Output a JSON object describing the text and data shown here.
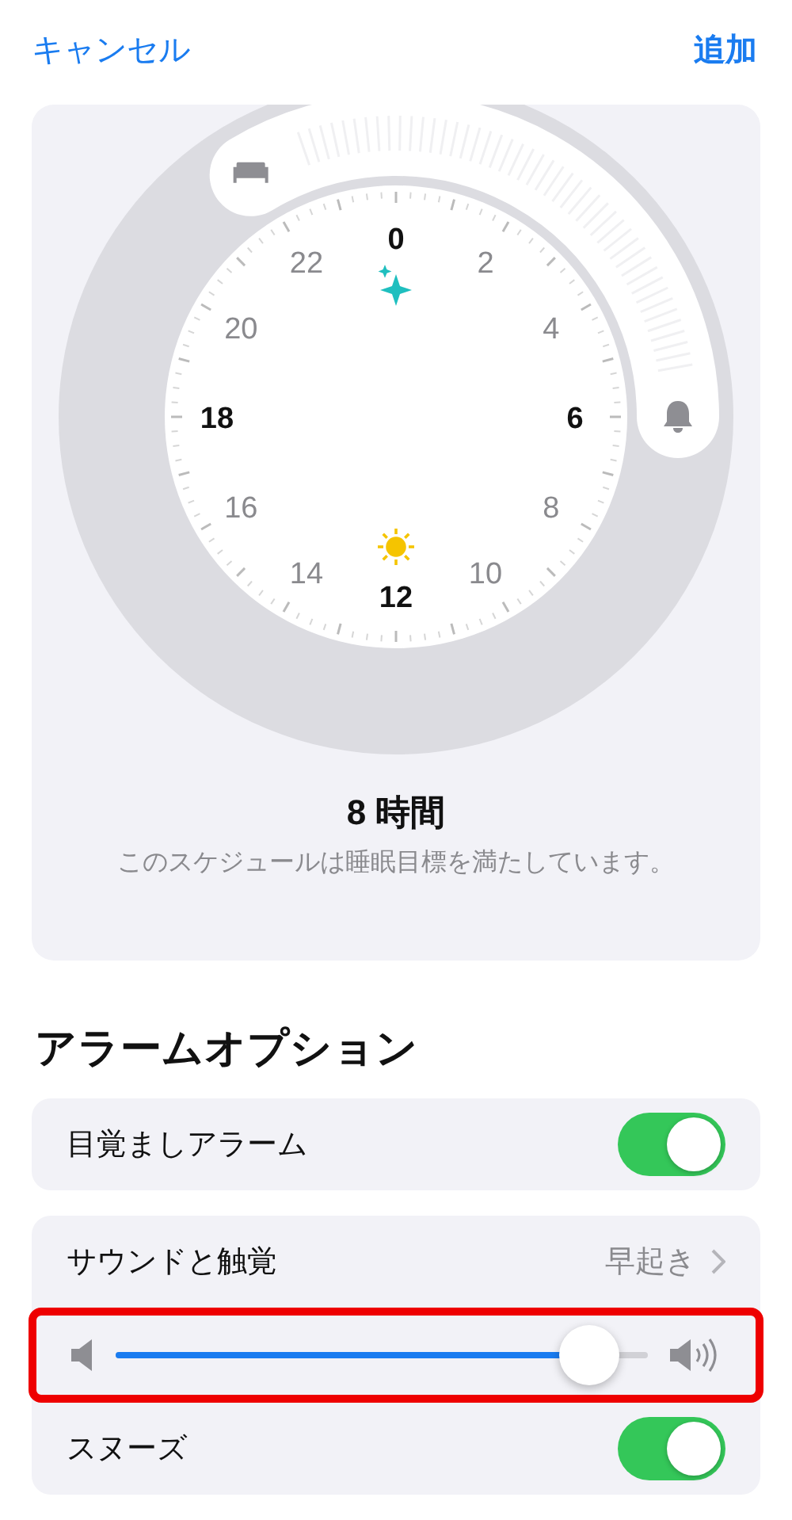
{
  "nav": {
    "cancel": "キャンセル",
    "add": "追加"
  },
  "clock": {
    "hour_labels": [
      {
        "label": "0",
        "bold": true
      },
      {
        "label": "2",
        "bold": false
      },
      {
        "label": "4",
        "bold": false
      },
      {
        "label": "6",
        "bold": true
      },
      {
        "label": "8",
        "bold": false
      },
      {
        "label": "10",
        "bold": false
      },
      {
        "label": "12",
        "bold": true
      },
      {
        "label": "14",
        "bold": false
      },
      {
        "label": "16",
        "bold": false
      },
      {
        "label": "18",
        "bold": true
      },
      {
        "label": "20",
        "bold": false
      },
      {
        "label": "22",
        "bold": false
      }
    ],
    "duration": "8 時間",
    "note": "このスケジュールは睡眠目標を満たしています。"
  },
  "section_title": "アラームオプション",
  "groups": [
    [
      {
        "kind": "toggle",
        "label": "目覚ましアラーム",
        "on": true
      }
    ],
    [
      {
        "kind": "link",
        "label": "サウンドと触覚",
        "value": "早起き"
      },
      {
        "kind": "slider",
        "level": 0.94,
        "highlighted": true
      },
      {
        "kind": "toggle",
        "label": "スヌーズ",
        "on": true
      }
    ]
  ]
}
